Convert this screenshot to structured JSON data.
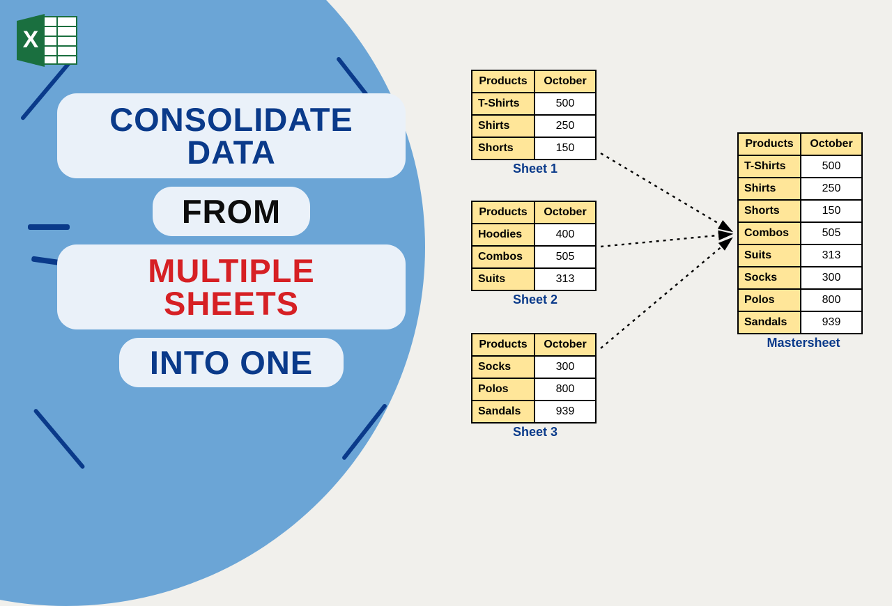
{
  "icon_name": "excel-icon",
  "title": {
    "line1": "CONSOLIDATE DATA",
    "line2": "FROM",
    "line3": "MULTIPLE SHEETS",
    "line4": "INTO ONE"
  },
  "sheets": [
    {
      "name": "Sheet 1",
      "header": [
        "Products",
        "October"
      ],
      "rows": [
        [
          "T-Shirts",
          "500"
        ],
        [
          "Shirts",
          "250"
        ],
        [
          "Shorts",
          "150"
        ]
      ]
    },
    {
      "name": "Sheet 2",
      "header": [
        "Products",
        "October"
      ],
      "rows": [
        [
          "Hoodies",
          "400"
        ],
        [
          "Combos",
          "505"
        ],
        [
          "Suits",
          "313"
        ]
      ]
    },
    {
      "name": "Sheet 3",
      "header": [
        "Products",
        "October"
      ],
      "rows": [
        [
          "Socks",
          "300"
        ],
        [
          "Polos",
          "800"
        ],
        [
          "Sandals",
          "939"
        ]
      ]
    }
  ],
  "master": {
    "name": "Mastersheet",
    "header": [
      "Products",
      "October"
    ],
    "rows": [
      [
        "T-Shirts",
        "500"
      ],
      [
        "Shirts",
        "250"
      ],
      [
        "Shorts",
        "150"
      ],
      [
        "Combos",
        "505"
      ],
      [
        "Suits",
        "313"
      ],
      [
        "Socks",
        "300"
      ],
      [
        "Polos",
        "800"
      ],
      [
        "Sandals",
        "939"
      ]
    ]
  },
  "colors": {
    "circle": "#6ba5d6",
    "accent": "#0a3a8a",
    "red": "#d62024",
    "bg": "#f1f0ec",
    "head": "#ffe699"
  }
}
